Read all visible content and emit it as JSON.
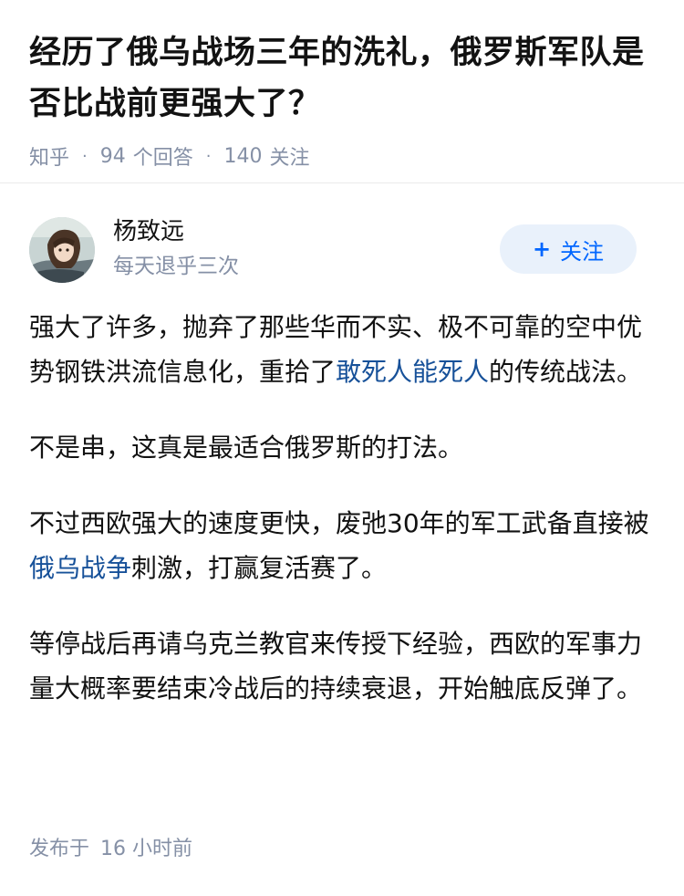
{
  "question": {
    "title": "经历了俄乌战场三年的洗礼，俄罗斯军队是否比战前更强大了？",
    "source": "知乎",
    "answers_count": "94",
    "answers_label": "个回答",
    "follow_count": "140",
    "follow_label": "关注"
  },
  "author": {
    "name": "杨致远",
    "bio": "每天退乎三次",
    "follow_button_label": "关注",
    "follow_button_icon": "plus-icon"
  },
  "answer": {
    "paragraphs": [
      {
        "before": "强大了许多，抛弃了那些华而不实、极不可靠的空中优势钢铁洪流信息化，重拾了",
        "link": "敢死人能死人",
        "after": "的传统战法。"
      },
      {
        "text": "不是串，这真是最适合俄罗斯的打法。"
      },
      {
        "before": "不过西欧强大的速度更快，废弛30年的军工武备直接被",
        "link": "俄乌战争",
        "after": "刺激，打赢复活赛了。"
      },
      {
        "text": "等停战后再请乌克兰教官来传授下经验，西欧的军事力量大概率要结束冷战后的持续衰退，开始触底反弹了。"
      }
    ]
  },
  "footer": {
    "published_label": "发布于",
    "published_time": "16 小时前"
  },
  "colors": {
    "link": "#175199",
    "accent": "#0066ff",
    "follow_bg": "#e9f1fb",
    "meta_text": "#8590a6"
  }
}
